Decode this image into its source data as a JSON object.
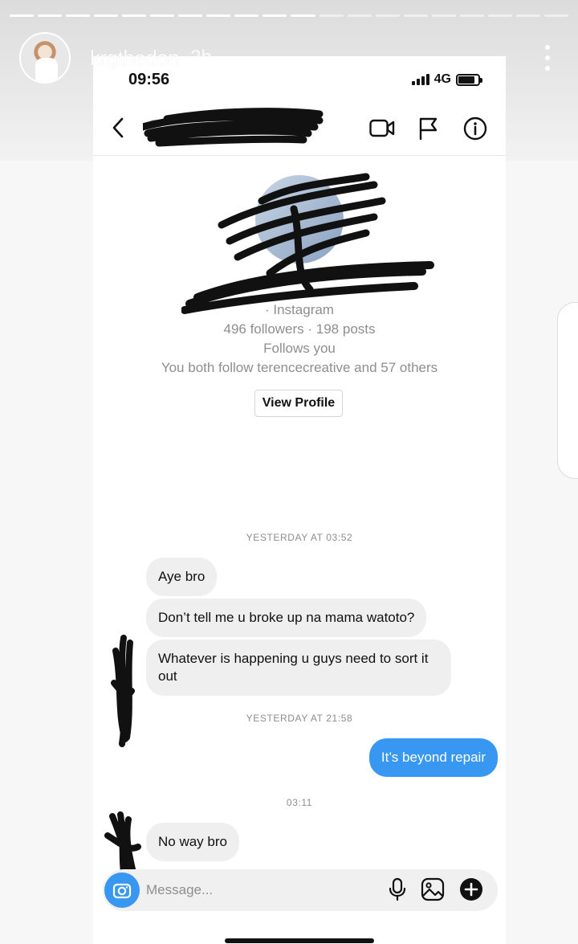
{
  "story": {
    "username": "krgthedon",
    "time_ago": "2h",
    "progress_total": 20,
    "progress_done": 11
  },
  "status_bar": {
    "time": "09:56",
    "network": "4G",
    "battery_level": 0.85
  },
  "dm_header": {
    "back_icon": "chevron-left-icon",
    "actions": [
      {
        "name": "video-call-icon"
      },
      {
        "name": "flag-icon"
      },
      {
        "name": "info-icon"
      }
    ]
  },
  "profile": {
    "username_line": "· Instagram",
    "stats": "496 followers · 198 posts",
    "follows": "Follows you",
    "mutual": "You both follow terencecreative and 57 others",
    "view_profile_label": "View Profile"
  },
  "conversation": {
    "divider_1": "YESTERDAY AT 03:52",
    "msg_1": "Aye bro",
    "msg_2": "Don’t tell me u broke up na mama watoto?",
    "msg_3": "Whatever is happening u guys need to sort it out",
    "divider_2": "YESTERDAY AT 21:58",
    "msg_4": "It’s beyond repair",
    "divider_3": "03:11",
    "msg_5": "No way bro"
  },
  "composer": {
    "placeholder": "Message..."
  },
  "colors": {
    "accent_blue": "#3897f0",
    "bubble_gray": "#efefef",
    "meta_gray": "#8e8e8e"
  }
}
